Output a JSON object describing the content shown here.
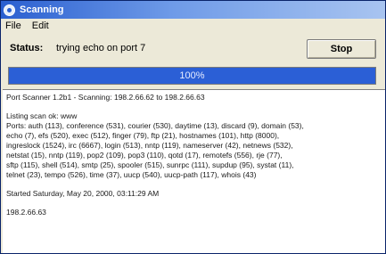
{
  "window": {
    "title": "Scanning"
  },
  "menu": {
    "items": [
      "File",
      "Edit"
    ]
  },
  "status": {
    "label": "Status:",
    "text": "trying echo on port 7",
    "stop_label": "Stop"
  },
  "progress": {
    "percent": 100,
    "text": "100%"
  },
  "output": {
    "header": "Port Scanner 1.2b1 - Scanning: 198.2.66.62 to 198.2.66.63",
    "listing_title": "Listing scan ok: www",
    "listing_lines": [
      "Ports: auth (113), conference (531), courier (530), daytime (13), discard (9), domain (53),",
      "echo (7), efs (520), exec (512), finger (79), ftp (21), hostnames (101), http (8000),",
      "ingreslock (1524), irc (6667), login (513), nntp (119), nameserver (42), netnews (532),",
      "netstat (15), nntp (119), pop2 (109), pop3 (110), qotd (17), remotefs (556), rje (77),",
      "sftp (115), shell (514), smtp (25), spooler (515), sunrpc (111), supdup (95), systat (11),",
      "telnet (23), tempo (526), time (37), uucp (540), uucp-path (117), whois (43)"
    ],
    "started": "Started Saturday, May 20, 2000, 03:11:29 AM",
    "current_host": "198.2.66.63"
  },
  "colors": {
    "progress_fill": "#2b5fd6",
    "titlebar_start": "#2a5fd0"
  }
}
